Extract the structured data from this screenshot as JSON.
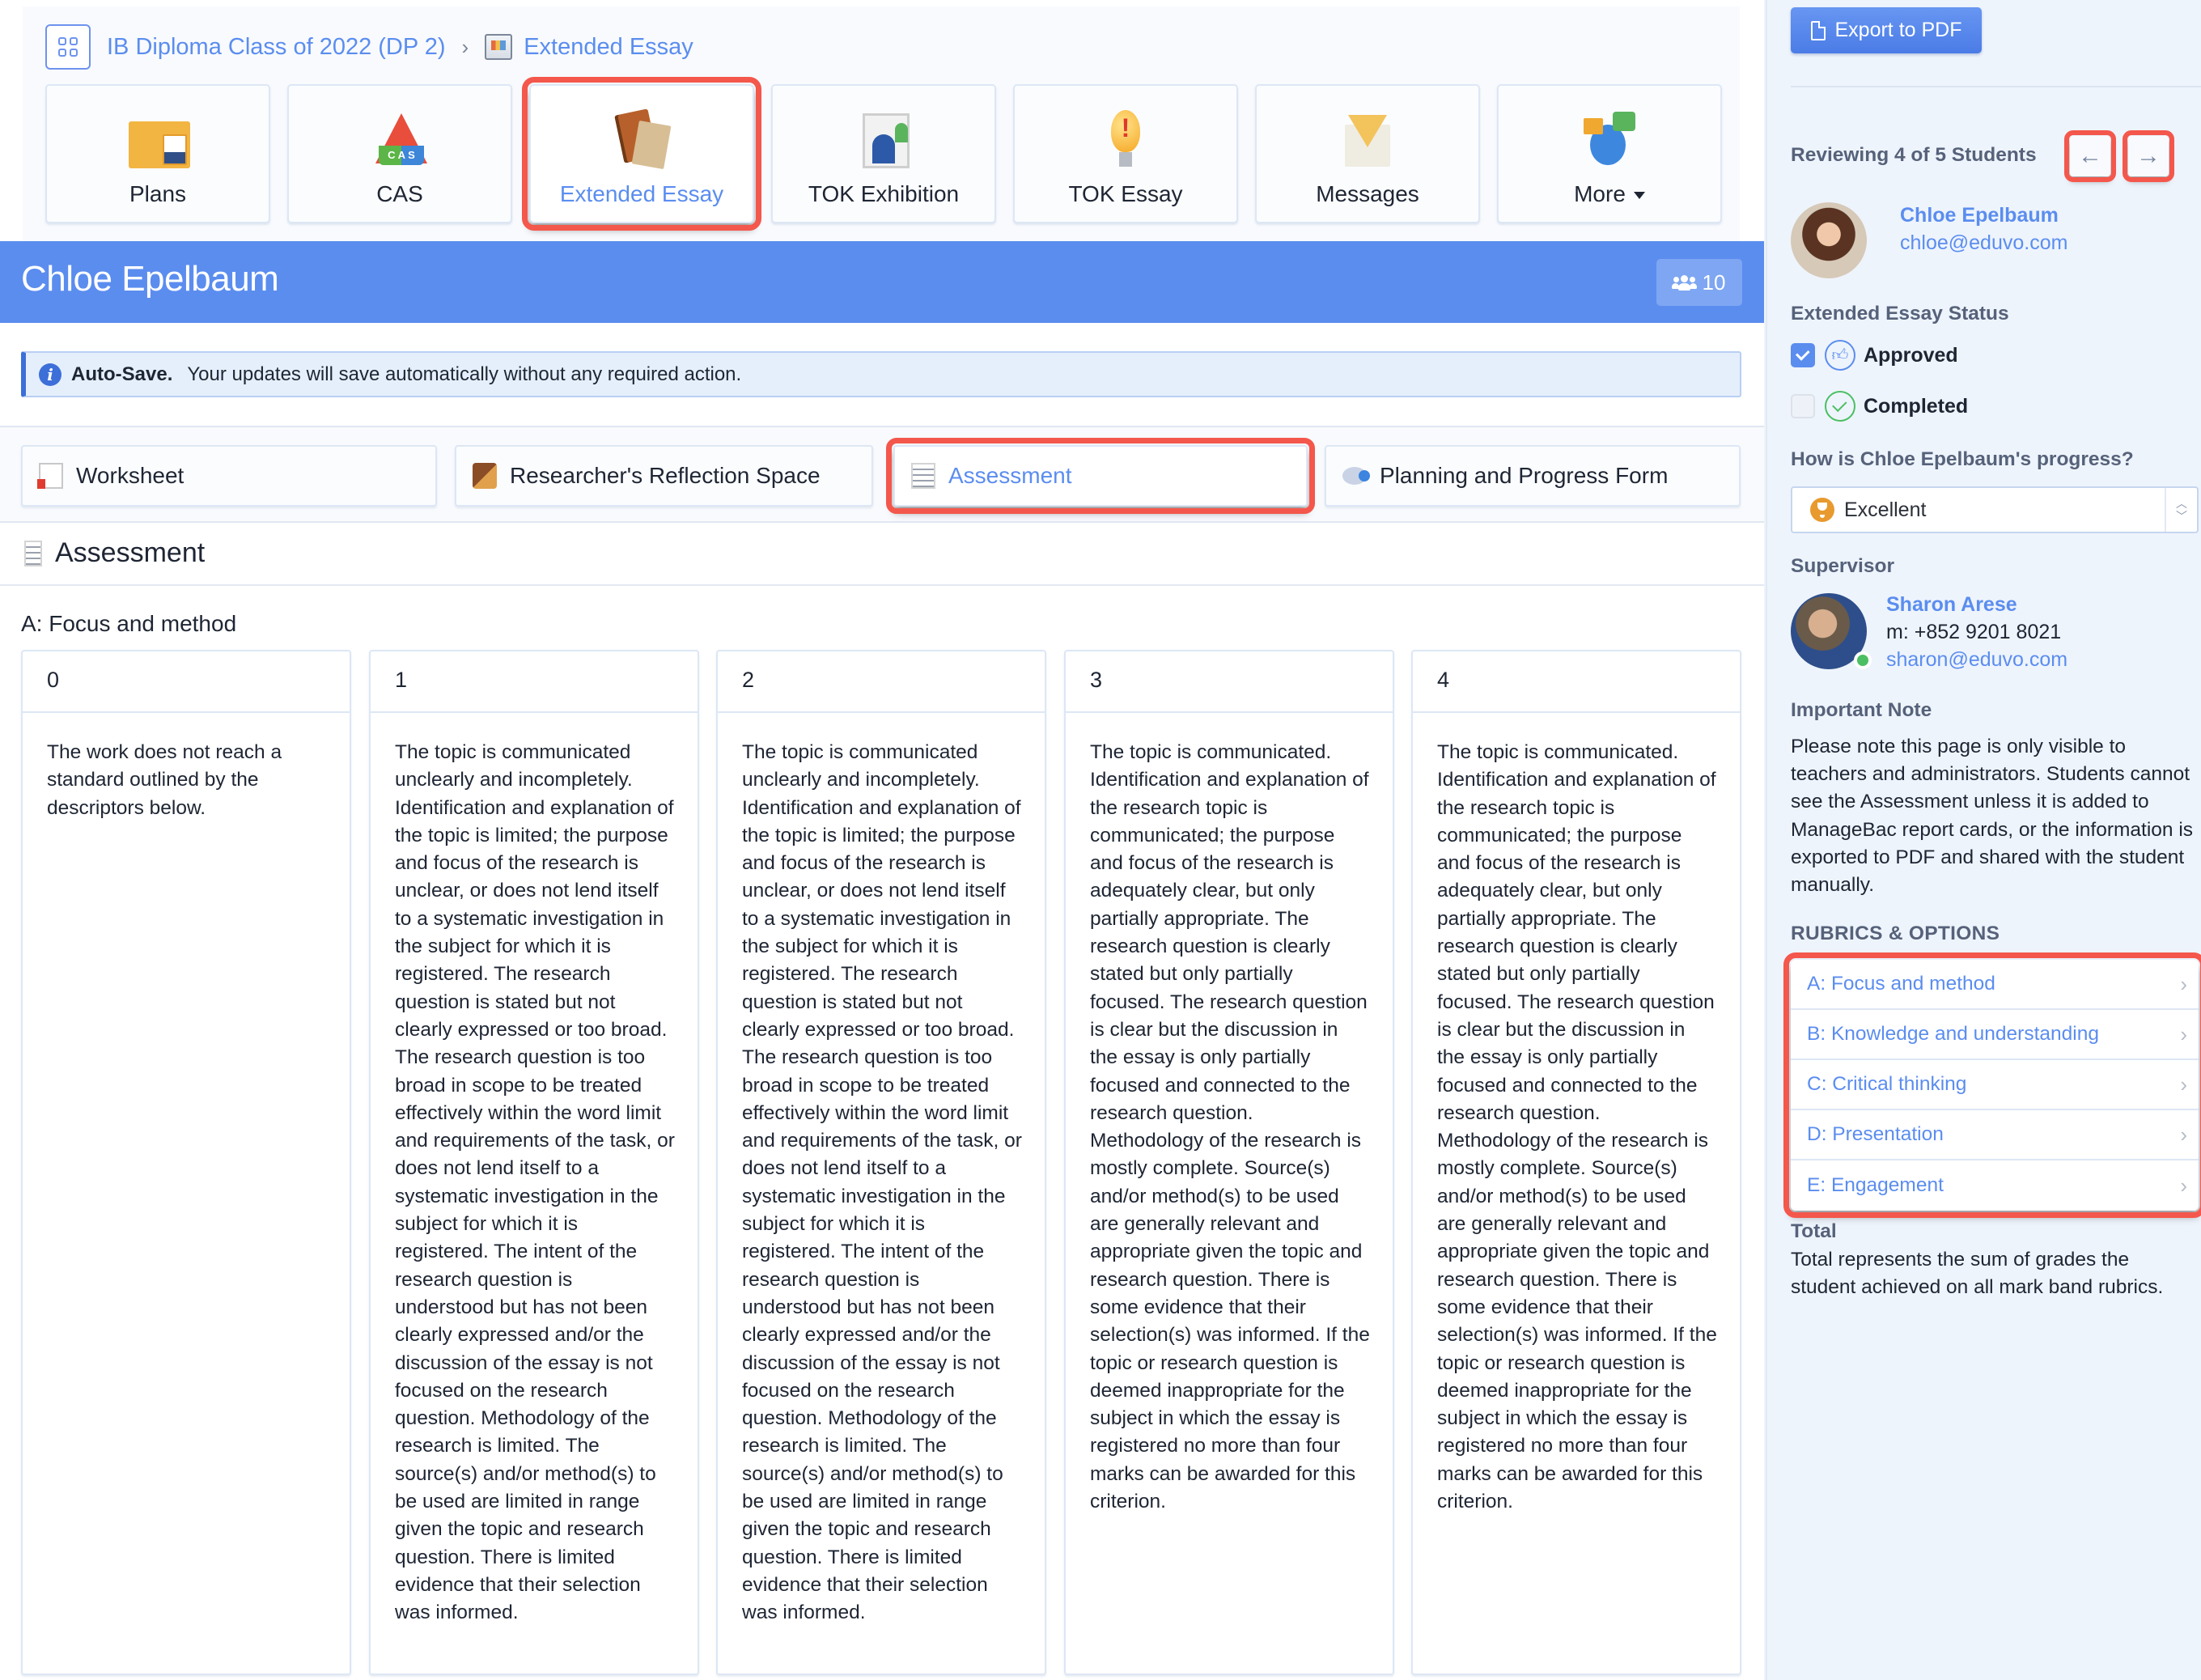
{
  "breadcrumb": {
    "app_switcher_icon": "grid-icon",
    "parent": "IB Diploma Class of 2022 (DP 2)",
    "separator": "›",
    "current_icon": "extended-essay-icon",
    "current": "Extended Essay"
  },
  "nav_tiles": [
    {
      "label": "Plans",
      "icon": "folder-profile-icon",
      "active": false
    },
    {
      "label": "CAS",
      "icon": "cas-triangle-icon",
      "active": false
    },
    {
      "label": "Extended Essay",
      "icon": "essay-books-icon",
      "active": true
    },
    {
      "label": "TOK Exhibition",
      "icon": "presentation-icon",
      "active": false
    },
    {
      "label": "TOK Essay",
      "icon": "lightbulb-icon",
      "active": false
    },
    {
      "label": "Messages",
      "icon": "envelope-icon",
      "active": false
    },
    {
      "label": "More",
      "icon": "ideas-chat-icon",
      "active": false,
      "has_dropdown": true
    }
  ],
  "banner": {
    "title": "Chloe Epelbaum",
    "members_icon": "users-icon",
    "members_count": "10",
    "color": "#5b8def"
  },
  "autosave": {
    "icon": "info-icon",
    "title": "Auto-Save.",
    "message": "Your updates will save automatically without any required action."
  },
  "tabs": [
    {
      "label": "Worksheet",
      "icon": "worksheet-icon",
      "active": false
    },
    {
      "label": "Researcher's Reflection Space",
      "icon": "theater-masks-icon",
      "active": false
    },
    {
      "label": "Assessment",
      "icon": "assessment-sheet-icon",
      "active": true
    },
    {
      "label": "Planning and Progress Form",
      "icon": "chat-bubble-icon",
      "active": false
    }
  ],
  "assessment": {
    "heading": "Assessment",
    "criterion": "A: Focus and method",
    "bands": [
      {
        "score": "0",
        "descriptor": "The work does not reach a standard outlined by the descriptors below."
      },
      {
        "score": "1",
        "descriptor": "The topic is communicated unclearly and incompletely. Identification and explanation of the topic is limited; the purpose and focus of the research is unclear, or does not lend itself to a systematic investigation in the subject for which it is registered. The research question is stated but not clearly expressed or too broad. The research question is too broad in scope to be treated effectively within the word limit and requirements of the task, or does not lend itself to a systematic investigation in the subject for which it is registered. The intent of the research question is understood but has not been clearly expressed and/or the discussion of the essay is not focused on the research question. Methodology of the research is limited. The source(s) and/or method(s) to be used are limited in range given the topic and research question. There is limited evidence that their selection was informed."
      },
      {
        "score": "2",
        "descriptor": "The topic is communicated unclearly and incompletely. Identification and explanation of the topic is limited; the purpose and focus of the research is unclear, or does not lend itself to a systematic investigation in the subject for which it is registered. The research question is stated but not clearly expressed or too broad. The research question is too broad in scope to be treated effectively within the word limit and requirements of the task, or does not lend itself to a systematic investigation in the subject for which it is registered. The intent of the research question is understood but has not been clearly expressed and/or the discussion of the essay is not focused on the research question. Methodology of the research is limited. The source(s) and/or method(s) to be used are limited in range given the topic and research question. There is limited evidence that their selection was informed."
      },
      {
        "score": "3",
        "descriptor": "The topic is communicated. Identification and explanation of the research topic is communicated; the purpose and focus of the research is adequately clear, but only partially appropriate. The research question is clearly stated but only partially focused. The research question is clear but the discussion in the essay is only partially focused and connected to the research question. Methodology of the research is mostly complete. Source(s) and/or method(s) to be used are generally relevant and appropriate given the topic and research question. There is some evidence that their selection(s) was informed. If the topic or research question is deemed inappropriate for the subject in which the essay is registered no more than four marks can be awarded for this criterion."
      },
      {
        "score": "4",
        "descriptor": "The topic is communicated. Identification and explanation of the research topic is communicated; the purpose and focus of the research is adequately clear, but only partially appropriate. The research question is clearly stated but only partially focused. The research question is clear but the discussion in the essay is only partially focused and connected to the research question. Methodology of the research is mostly complete. Source(s) and/or method(s) to be used are generally relevant and appropriate given the topic and research question. There is some evidence that their selection(s) was informed. If the topic or research question is deemed inappropriate for the subject in which the essay is registered no more than four marks can be awarded for this criterion."
      }
    ]
  },
  "sidebar": {
    "export_label": "Export to PDF",
    "export_icon": "pdf-file-icon",
    "reviewing_label": "Reviewing 4 of 5 Students",
    "prev_icon": "arrow-left-icon",
    "prev_glyph": "←",
    "next_icon": "arrow-right-icon",
    "next_glyph": "→",
    "student": {
      "name": "Chloe Epelbaum",
      "email": "chloe@eduvo.com"
    },
    "status_label": "Extended Essay Status",
    "statuses": [
      {
        "label": "Approved",
        "checked": true,
        "icon": "thumbs-up-icon"
      },
      {
        "label": "Completed",
        "checked": false,
        "icon": "check-circle-icon"
      }
    ],
    "progress_question": "How is Chloe Epelbaum's progress?",
    "progress_value": "Excellent",
    "progress_icon": "trophy-icon",
    "supervisor_label": "Supervisor",
    "supervisor": {
      "name": "Sharon Arese",
      "phone": "m: +852 9201 8021",
      "email": "sharon@eduvo.com",
      "online": true
    },
    "note_label": "Important Note",
    "note_text": "Please note this page is only visible to teachers and administrators. Students cannot see the Assessment unless it is added to ManageBac report cards, or the information is exported to PDF and shared with the student manually.",
    "rubrics_label": "RUBRICS & OPTIONS",
    "rubrics": [
      {
        "label": "A: Focus and method"
      },
      {
        "label": "B: Knowledge and understanding"
      },
      {
        "label": "C: Critical thinking"
      },
      {
        "label": "D: Presentation"
      },
      {
        "label": "E: Engagement"
      }
    ],
    "chevron_glyph": "›",
    "total_label": "Total",
    "total_text": "Total represents the sum of grades the student achieved on all mark band rubrics."
  }
}
